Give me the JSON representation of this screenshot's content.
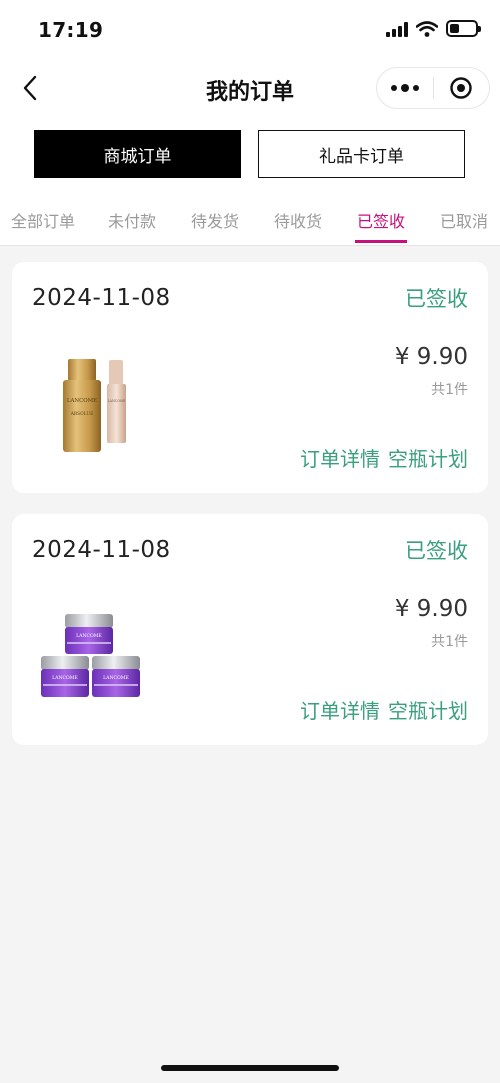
{
  "status_bar": {
    "time": "17:19"
  },
  "nav": {
    "title": "我的订单"
  },
  "segments": {
    "active_label": "商城订单",
    "inactive_label": "礼品卡订单"
  },
  "tabs": [
    {
      "label": "全部订单",
      "active": false
    },
    {
      "label": "未付款",
      "active": false
    },
    {
      "label": "待发货",
      "active": false
    },
    {
      "label": "待收货",
      "active": false
    },
    {
      "label": "已签收",
      "active": true
    },
    {
      "label": "已取消",
      "active": false
    }
  ],
  "orders": [
    {
      "date": "2024-11-08",
      "status": "已签收",
      "price": "¥ 9.90",
      "count": "共1件",
      "product_brand": "LANCOME",
      "product_line": "ABSOLUE",
      "actions": [
        "订单详情",
        "空瓶计划"
      ]
    },
    {
      "date": "2024-11-08",
      "status": "已签收",
      "price": "¥ 9.90",
      "count": "共1件",
      "product_brand": "LANCOME",
      "actions": [
        "订单详情",
        "空瓶计划"
      ]
    }
  ],
  "colors": {
    "accent_tab": "#c8107d",
    "status_green": "#3aa07c",
    "page_bg": "#f3f4f3"
  }
}
